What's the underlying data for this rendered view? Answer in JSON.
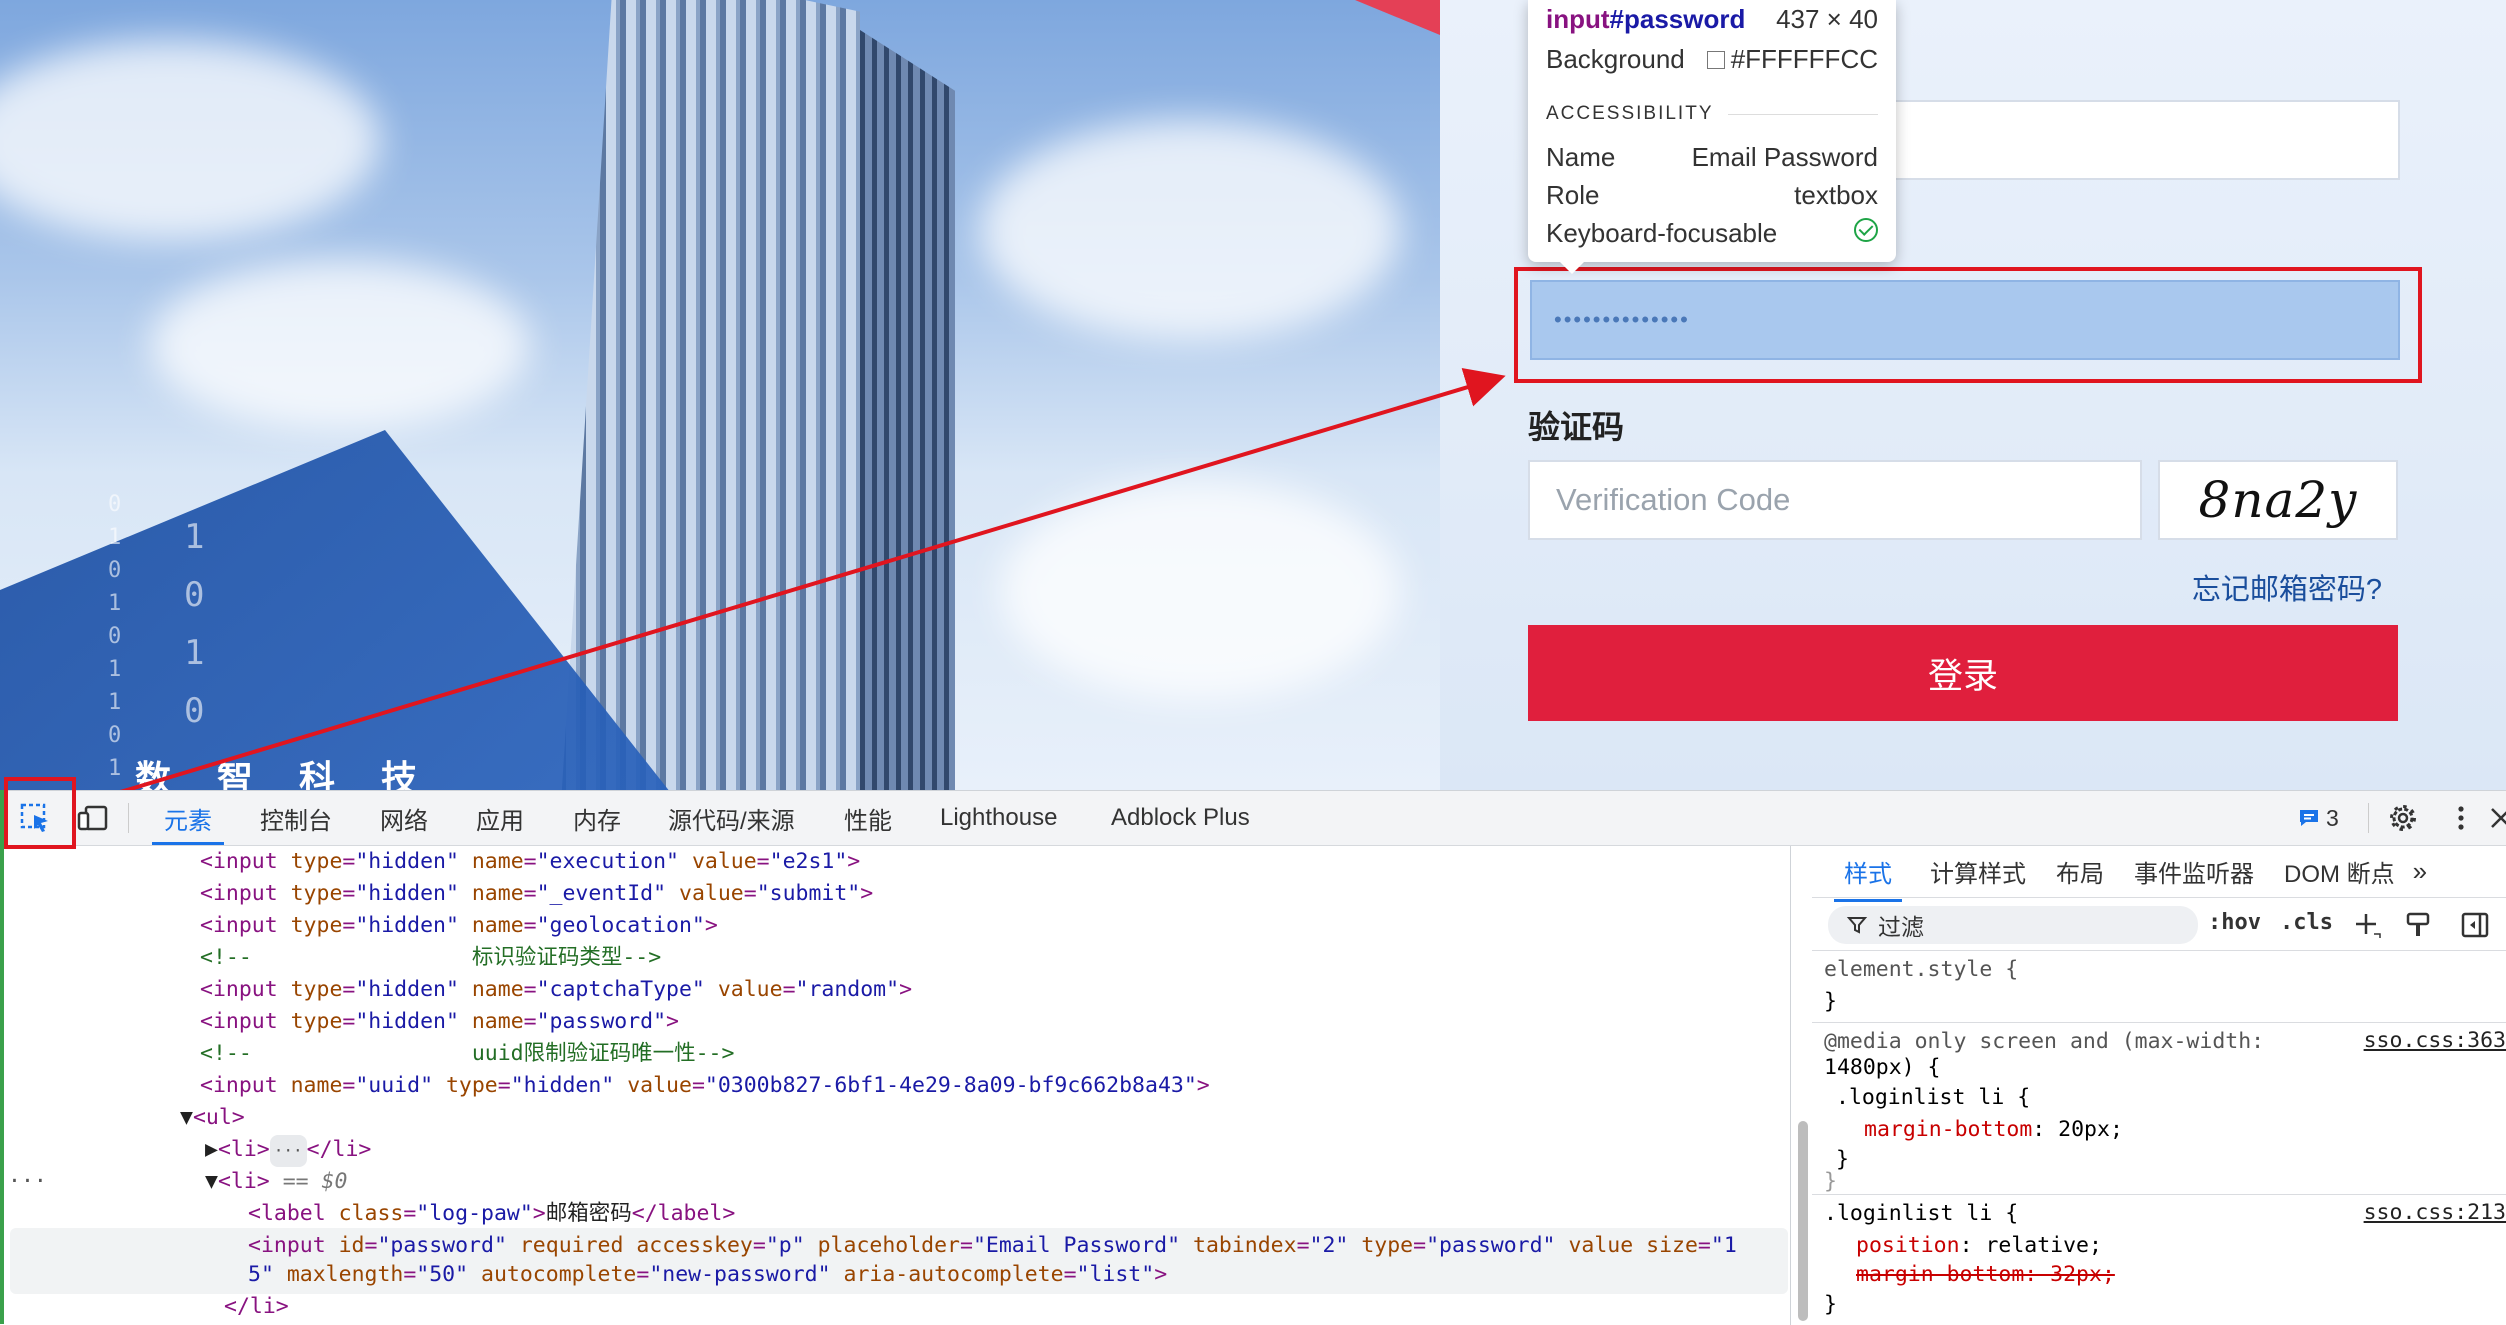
{
  "page": {
    "brand_text": "数 智 科 技",
    "binary_col1": [
      "0",
      "1",
      "0",
      "1",
      "0",
      "1",
      "1",
      "0",
      "1"
    ],
    "binary_col2": [
      "1",
      "0",
      "1",
      "0"
    ]
  },
  "tooltip": {
    "selector_tag": "input",
    "selector_id": "#password",
    "dimensions": "437 × 40",
    "bg_label": "Background",
    "bg_value": "#FFFFFFCC",
    "accessibility_title": "ACCESSIBILITY",
    "name_label": "Name",
    "name_value": "Email Password",
    "role_label": "Role",
    "role_value": "textbox",
    "focus_label": "Keyboard-focusable"
  },
  "login": {
    "password_dots": "••••••••••••••",
    "captcha_label": "验证码",
    "captcha_placeholder": "Verification Code",
    "captcha_image_text": "8na2y",
    "forgot_link": "忘记邮箱密码?",
    "login_button": "登录"
  },
  "devtools": {
    "tabs": [
      "元素",
      "控制台",
      "网络",
      "应用",
      "内存",
      "源代码/来源",
      "性能",
      "Lighthouse",
      "Adblock Plus"
    ],
    "issues_count": "3",
    "styles_tabs": [
      "样式",
      "计算样式",
      "布局",
      "事件监听器",
      "DOM 断点"
    ],
    "filter_label": "过滤",
    "hov": ":hov",
    "cls": ".cls",
    "selected_marker": "== $0",
    "styles": {
      "element_style": "element.style {",
      "media_query": "@media only screen and (max-width:",
      "media_query2": "1480px) {",
      "rule1_selector": ".loginlist li {",
      "rule1_prop": "margin-bottom",
      "rule1_value": "20px;",
      "rule2_selector": ".loginlist li {",
      "rule2_prop": "position",
      "rule2_value": "relative;",
      "rule2_struck": "margin-bottom: 32px;",
      "source1": "sso.css:363",
      "source2": "sso.css:213"
    }
  },
  "colors": {
    "accent": "#1a73e8",
    "highlight_red": "#e0151f",
    "login_red": "#e01f3d"
  }
}
